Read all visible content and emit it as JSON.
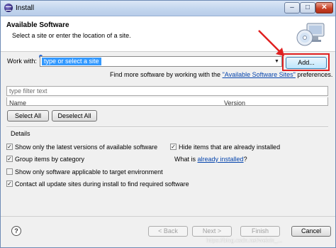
{
  "window": {
    "title": "Install"
  },
  "header": {
    "title": "Available Software",
    "subtitle": "Select a site or enter the location of a site."
  },
  "work_with": {
    "label": "Work with:",
    "value": "type or select a site",
    "add_button": "Add..."
  },
  "find_more": {
    "prefix": "Find more software by working with the ",
    "link": "\"Available Software Sites\"",
    "suffix": " preferences."
  },
  "filter": {
    "placeholder": "type filter text"
  },
  "tree": {
    "columns": [
      "Name",
      "Version"
    ]
  },
  "buttons": {
    "select_all": "Select All",
    "deselect_all": "Deselect All"
  },
  "details": {
    "label": "Details",
    "options": [
      {
        "label": "Show only the latest versions of available software",
        "checked": true
      },
      {
        "label": "Group items by category",
        "checked": true
      },
      {
        "label": "Show only software applicable to target environment",
        "checked": false
      },
      {
        "label": "Contact all update sites during install to find required software",
        "checked": true
      },
      {
        "label": "Hide items that are already installed",
        "checked": true
      }
    ],
    "what_is_prefix": "What is ",
    "what_is_link": "already installed",
    "what_is_suffix": "?"
  },
  "footer": {
    "help": "?",
    "back": "< Back",
    "next": "Next >",
    "finish": "Finish",
    "cancel": "Cancel"
  },
  "watermark": "https://blog.csdn.net/weixin_..."
}
